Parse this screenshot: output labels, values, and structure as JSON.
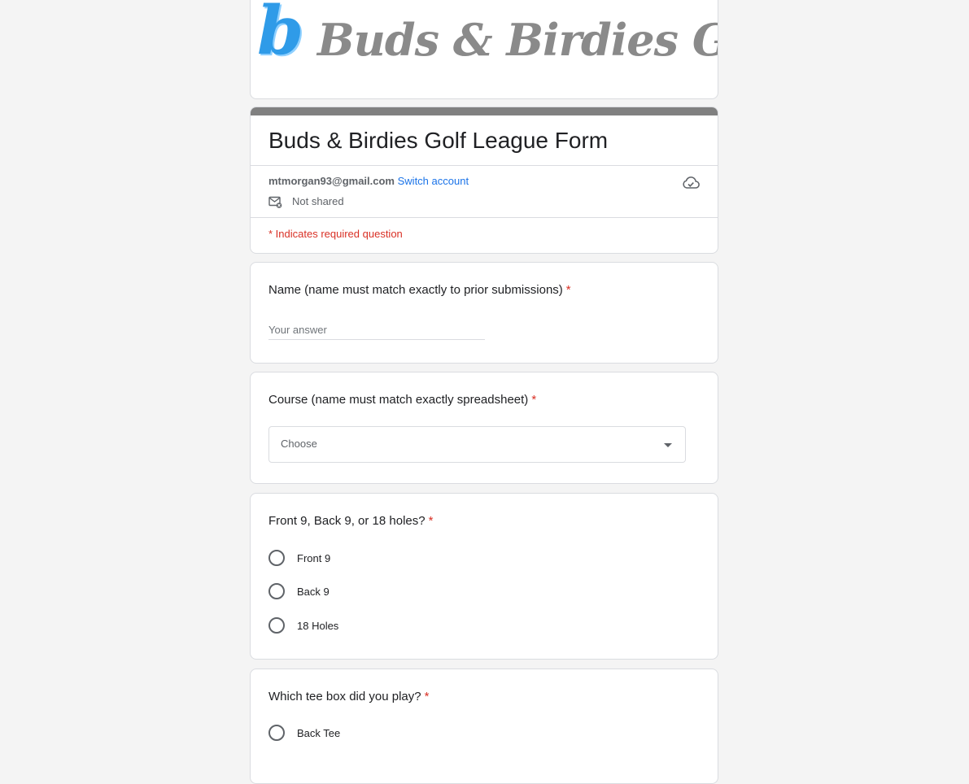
{
  "banner": {
    "logo_letter": "b",
    "logo_text": "Buds & Birdies Golf"
  },
  "form": {
    "title": "Buds & Birdies Golf League Form",
    "account_email": "mtmorgan93@gmail.com",
    "switch_account": "Switch account",
    "not_shared": "Not shared",
    "required_note": "* Indicates required question"
  },
  "questions": [
    {
      "title": "Name (name must match exactly to prior submissions)",
      "required_mark": "*",
      "placeholder": "Your answer",
      "value": ""
    },
    {
      "title": "Course (name must match exactly spreadsheet)",
      "required_mark": "*",
      "select_value": "Choose"
    },
    {
      "title": "Front 9, Back 9, or 18 holes?",
      "required_mark": "*",
      "options": [
        "Front 9",
        "Back 9",
        "18 Holes"
      ]
    },
    {
      "title": "Which tee box did you play?",
      "required_mark": "*",
      "options": [
        "Back Tee"
      ]
    }
  ],
  "colors": {
    "accent_bar": "#808080",
    "link": "#1a73e8",
    "required": "#d93025",
    "logo_blue": "#2f9be8"
  }
}
